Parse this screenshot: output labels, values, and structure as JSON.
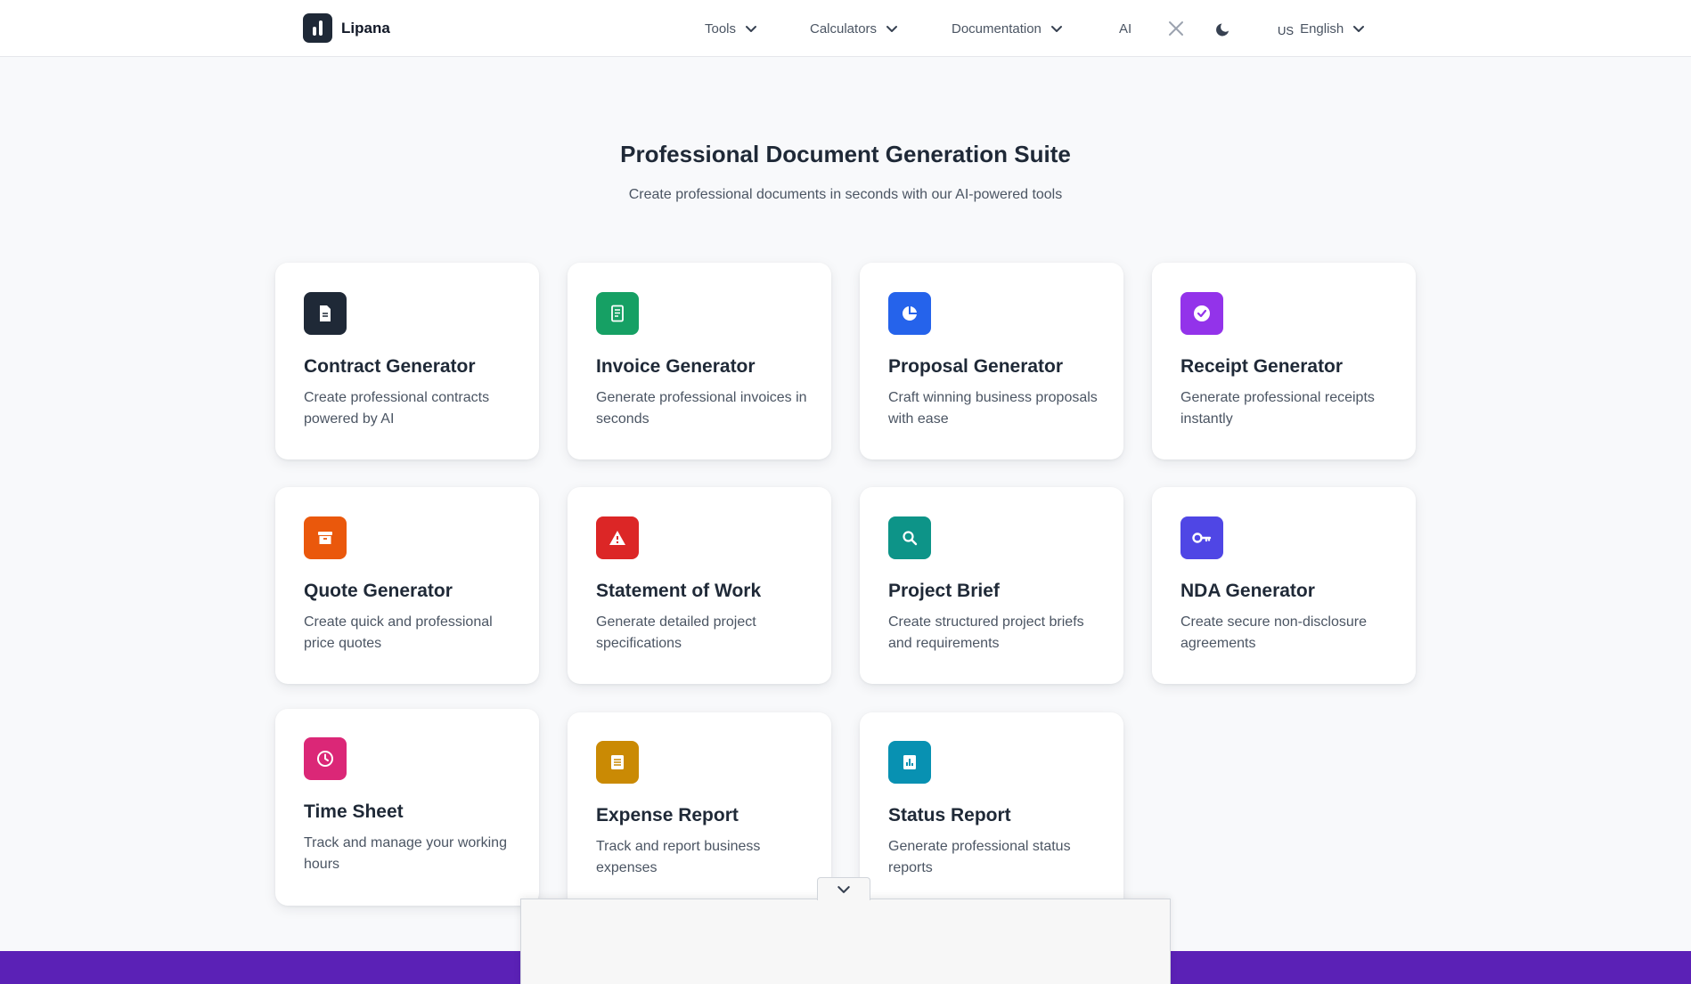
{
  "header": {
    "logo_text": "Lipana",
    "nav": [
      {
        "label": "Tools"
      },
      {
        "label": "Calculators"
      },
      {
        "label": "Documentation"
      },
      {
        "label": "AI"
      }
    ],
    "language": {
      "flag_text": "US",
      "label": "English"
    }
  },
  "hero": {
    "title": "Professional Document Generation Suite",
    "subtitle": "Create professional documents in seconds with our AI-powered tools"
  },
  "cards": [
    {
      "title": "Contract Generator",
      "desc": "Create professional contracts powered by AI",
      "icon": "document-icon",
      "color": "#1f2937"
    },
    {
      "title": "Invoice Generator",
      "desc": "Generate professional invoices in seconds",
      "icon": "invoice-icon",
      "color": "#16a064"
    },
    {
      "title": "Proposal Generator",
      "desc": "Craft winning business proposals with ease",
      "icon": "pie-chart-icon",
      "color": "#2563eb"
    },
    {
      "title": "Receipt Generator",
      "desc": "Generate professional receipts instantly",
      "icon": "check-badge-icon",
      "color": "#9333ea"
    },
    {
      "title": "Quote Generator",
      "desc": "Create quick and professional price quotes",
      "icon": "archive-icon",
      "color": "#ea580c"
    },
    {
      "title": "Statement of Work",
      "desc": "Generate detailed project specifications",
      "icon": "warning-icon",
      "color": "#dc2626"
    },
    {
      "title": "Project Brief",
      "desc": "Create structured project briefs and requirements",
      "icon": "search-icon",
      "color": "#0d9488"
    },
    {
      "title": "NDA Generator",
      "desc": "Create secure non-disclosure agreements",
      "icon": "key-icon",
      "color": "#4f46e5"
    },
    {
      "title": "Time Sheet",
      "desc": "Track and manage your working hours",
      "icon": "clock-icon",
      "color": "#db2777"
    },
    {
      "title": "Expense Report",
      "desc": "Track and report business expenses",
      "icon": "list-icon",
      "color": "#ca8a04"
    },
    {
      "title": "Status Report",
      "desc": "Generate professional status reports",
      "icon": "bar-chart-icon",
      "color": "#0891b2"
    }
  ],
  "colors": {
    "footer_band": "#5b21b6"
  }
}
